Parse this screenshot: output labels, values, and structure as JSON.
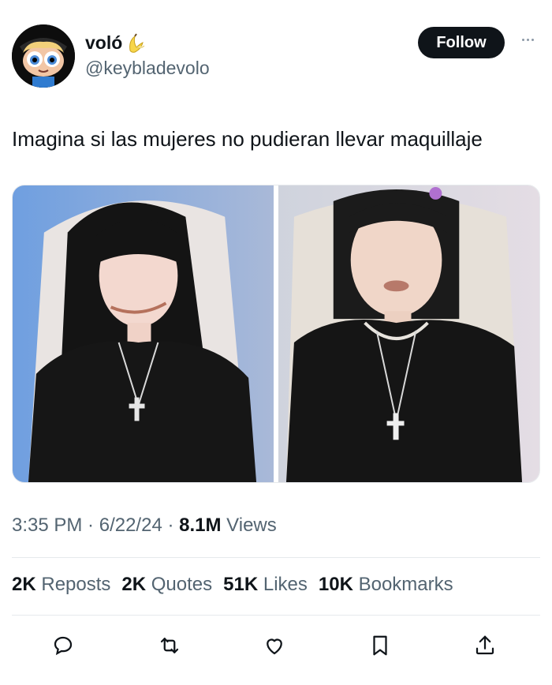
{
  "author": {
    "display_name": "voló",
    "handle": "@keybladevolo",
    "emoji": "banana-emoji"
  },
  "follow_label": "Follow",
  "tweet": {
    "text": "Imagina si las mujeres no pudieran llevar maquillaje"
  },
  "media": [
    {
      "alt": "photo-with-makeup"
    },
    {
      "alt": "photo-without-makeup"
    }
  ],
  "meta": {
    "time": "3:35 PM",
    "date": "6/22/24",
    "views_count": "8.1M",
    "views_label": "Views"
  },
  "stats": {
    "reposts_count": "2K",
    "reposts_label": "Reposts",
    "quotes_count": "2K",
    "quotes_label": "Quotes",
    "likes_count": "51K",
    "likes_label": "Likes",
    "bookmarks_count": "10K",
    "bookmarks_label": "Bookmarks"
  },
  "actions": [
    "reply-icon",
    "repost-icon",
    "like-icon",
    "bookmark-icon",
    "share-icon"
  ],
  "colors": {
    "text": "#0f1419",
    "secondary": "#536471",
    "divider": "#e6e9ec",
    "button_bg": "#0f1419"
  }
}
